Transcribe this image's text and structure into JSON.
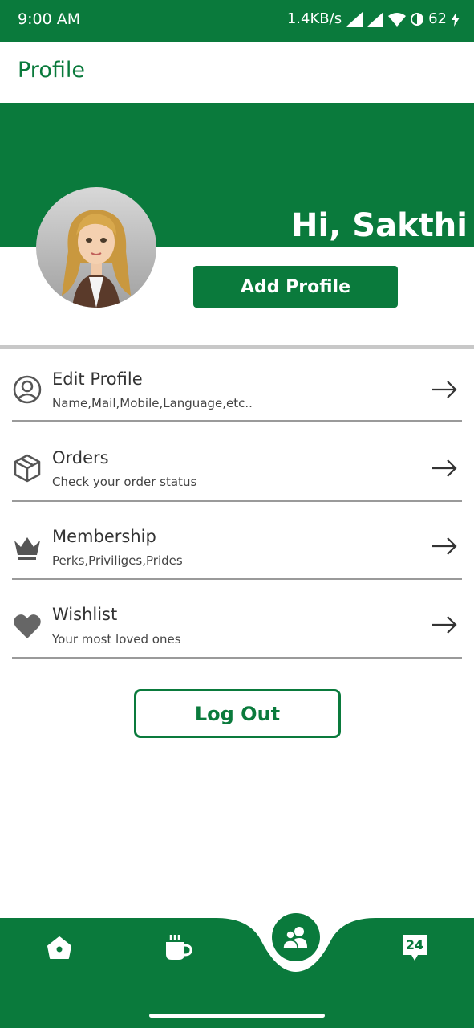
{
  "status": {
    "time": "9:00 AM",
    "network_speed": "1.4KB/s",
    "battery": "62"
  },
  "header": {
    "title": "Profile"
  },
  "profile": {
    "greeting": "Hi, Sakthi",
    "add_profile_label": "Add  Profile"
  },
  "menu": [
    {
      "title": "Edit Profile",
      "subtitle": "Name,Mail,Mobile,Language,etc..",
      "icon": "user-circle-icon"
    },
    {
      "title": "Orders",
      "subtitle": "Check your order status",
      "icon": "box-icon"
    },
    {
      "title": "Membership",
      "subtitle": "Perks,Priviliges,Prides",
      "icon": "crown-icon"
    },
    {
      "title": "Wishlist",
      "subtitle": "Your most loved ones",
      "icon": "heart-icon"
    }
  ],
  "logout_label": "Log Out",
  "bottom_nav": {
    "items": [
      "home-icon",
      "cup-icon",
      "people-icon",
      "support-24-icon"
    ],
    "support_badge": "24",
    "active": "people-icon"
  },
  "colors": {
    "brand": "#0a7a3c",
    "divider": "#9a9a9a"
  }
}
